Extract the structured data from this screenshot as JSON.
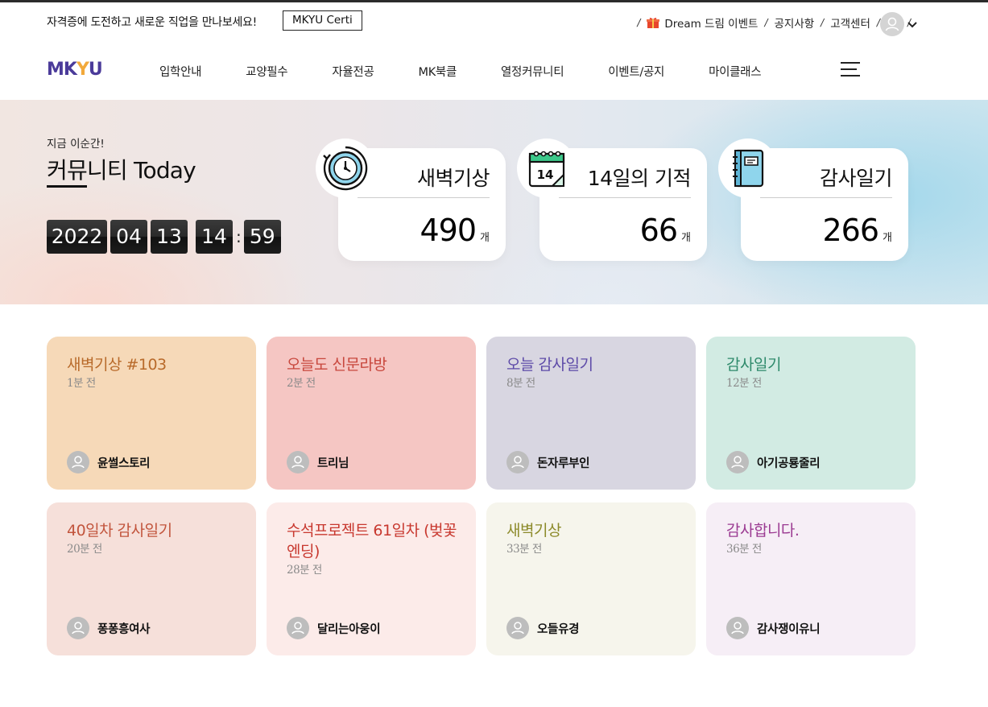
{
  "topbar": {
    "promo": "자격증에 도전하고 새로운 직업을 만나보세요!",
    "certi_button": "MKYU Certi",
    "links": [
      "Dream 드림 이벤트",
      "공지사항",
      "고객센터"
    ]
  },
  "nav": {
    "logo": "MKYU",
    "items": [
      "입학안내",
      "교양필수",
      "자율전공",
      "MK북클",
      "열정커뮤니티",
      "이벤트/공지",
      "마이클래스"
    ]
  },
  "hero": {
    "kicker": "지금 이순간!",
    "title": "커뮤니티 Today",
    "clock": {
      "year": "2022",
      "month": "04",
      "day": "13",
      "hour": "14",
      "minute": "59"
    },
    "stats": [
      {
        "label": "새벽기상",
        "count": "490",
        "unit": "개",
        "icon": "alarm-clock-icon"
      },
      {
        "label": "14일의 기적",
        "count": "66",
        "unit": "개",
        "icon": "calendar-icon"
      },
      {
        "label": "감사일기",
        "count": "266",
        "unit": "개",
        "icon": "notebook-icon"
      }
    ]
  },
  "cards": [
    {
      "title": "새벽기상 #103",
      "time": "1분 전",
      "author": "윤썰스토리",
      "bg": "#f6d9b8",
      "color": "#b86a2a"
    },
    {
      "title": "오늘도 신문라방",
      "time": "2분 전",
      "author": "트리님",
      "bg": "#f5c6c3",
      "color": "#c8473d"
    },
    {
      "title": "오늘 감사일기",
      "time": "8분 전",
      "author": "돈자루부인",
      "bg": "#d8d6e1",
      "color": "#5d4aa8"
    },
    {
      "title": "감사일기",
      "time": "12분 전",
      "author": "아기공룡줄리",
      "bg": "#d2ebe3",
      "color": "#2e8a6b"
    },
    {
      "title": "40일차 감사일기",
      "time": "20분 전",
      "author": "퐁퐁흥여사",
      "bg": "#f6e0da",
      "color": "#c2553d"
    },
    {
      "title": "수석프로젝트 61일차 (벚꽃 엔딩)",
      "time": "28분 전",
      "author": "달리는아웅이",
      "bg": "#fcebe9",
      "color": "#c8382f"
    },
    {
      "title": "새벽기상",
      "time": "33분 전",
      "author": "오들유경",
      "bg": "#f6f5ec",
      "color": "#8c8a2a"
    },
    {
      "title": "감사합니다.",
      "time": "36분 전",
      "author": "감사쟁이유니",
      "bg": "#f6eef6",
      "color": "#9b3a92"
    }
  ],
  "colors": {
    "brand": "#4b3b9a",
    "brand_accent": "#f2a93b"
  }
}
